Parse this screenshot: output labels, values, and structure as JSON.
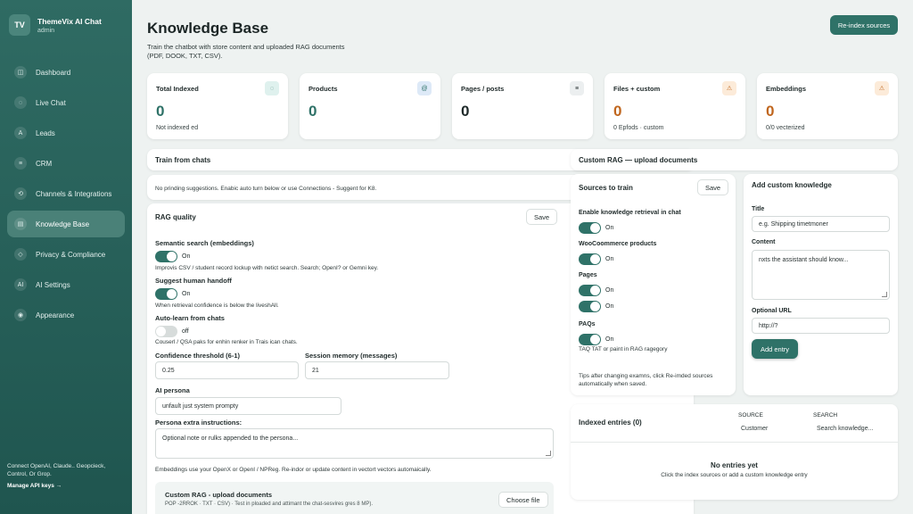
{
  "brand": {
    "initials": "TV",
    "title": "ThemeVix AI Chat",
    "subtitle": "admin"
  },
  "nav": [
    {
      "label": "Dashboard",
      "icon": "grid-icon",
      "glyph": "◫"
    },
    {
      "label": "Live Chat",
      "icon": "chat-icon",
      "glyph": "◌"
    },
    {
      "label": "Leads",
      "icon": "leads-icon",
      "glyph": "A"
    },
    {
      "label": "CRM",
      "icon": "database-icon",
      "glyph": "≡"
    },
    {
      "label": "Channels & Integrations",
      "icon": "channels-icon",
      "glyph": "⟲"
    },
    {
      "label": "Knowledge Base",
      "icon": "book-icon",
      "glyph": "▤"
    },
    {
      "label": "Privacy & Compliance",
      "icon": "shield-icon",
      "glyph": "◇"
    },
    {
      "label": "AI Settings",
      "icon": "ai-icon",
      "glyph": "AI"
    },
    {
      "label": "Appearance",
      "icon": "palette-icon",
      "glyph": "◉"
    }
  ],
  "sidebar_footer": {
    "text": "Connect OpenAI, Claude.. Geopcieck, Control, Or Grop.",
    "link": "Manage API keys →"
  },
  "header": {
    "title": "Knowledge Base",
    "subtitle": "Train the chatbot with store content and uploaded RAG documents (PDF, DOOK, TXT, CSV).",
    "reindex_label": "Re-index sources"
  },
  "stats": [
    {
      "label": "Total Indexed",
      "value": "0",
      "sub": "Not indexed ed",
      "icon": "chat-bubble-icon",
      "glyph": "◌",
      "color": "#2f7268",
      "icon_bg": "#dff1ee"
    },
    {
      "label": "Products",
      "value": "0",
      "sub": "",
      "icon": "at-icon",
      "glyph": "@",
      "color": "#2f7268",
      "icon_bg": "#dde9f7"
    },
    {
      "label": "Pages / posts",
      "value": "0",
      "sub": "",
      "icon": "list-icon",
      "glyph": "≡",
      "color": "#1f2a2a",
      "icon_bg": "#eceff0"
    },
    {
      "label": "Files + custom",
      "value": "0",
      "sub": "0 Epfods · custom",
      "icon": "warning-icon",
      "glyph": "⚠",
      "color": "#c0661e",
      "icon_bg": "#fcebd9"
    },
    {
      "label": "Embeddings",
      "value": "0",
      "sub": "0/0 vecterized",
      "icon": "warning-icon",
      "glyph": "⚠",
      "color": "#c0661e",
      "icon_bg": "#fcebd9"
    }
  ],
  "train_from_chats": {
    "title": "Train from chats",
    "text": "No prinding suggestions. Enabic auto turn below or use Connections - Suggent for K8."
  },
  "rag_quality": {
    "title": "RAG quality",
    "save_label": "Save",
    "semantic": {
      "label": "Semantic search (embeddings)",
      "state": "On",
      "on": true,
      "help": "Improvis CSV / student record lockup with netict search. Search; OpenI? or Gemni key."
    },
    "handoff": {
      "label": "Suggest human handoff",
      "state": "On",
      "on": true,
      "help": "When retrieval confidence is below the liveshAll."
    },
    "autolearn": {
      "label": "Auto-learn from chats",
      "state": "off",
      "on": false,
      "help": "Couserl / QSA paks for enhin renker in Trais ican chats."
    },
    "confidence": {
      "label": "Confidence threshold (6-1)",
      "value": "0.25"
    },
    "memory": {
      "label": "Session memory (messages)",
      "value": "21"
    },
    "persona": {
      "label": "AI persona",
      "value": "unfault just system prompty"
    },
    "persona_extra": {
      "label": "Persona extra instructions:",
      "placeholder": "Optional note or rulks appended to the persona..."
    },
    "footnote": "Embeddings use your OpenX or OpenI / NPReg. Re-indor or update content in vectort vectors automaically."
  },
  "custom_rag_inner": {
    "title": "Custom RAG - upload documents",
    "sub": "POP -2RROK · TXT · CSV)  ·  Test in ploaded and attimant the chat-sesvires gres 8 MP).",
    "button": "Choose file"
  },
  "custom_rag": {
    "title": "Custom RAG — upload documents"
  },
  "sources": {
    "title": "Sources to train",
    "save_label": "Save",
    "items": [
      {
        "label": "Enable knowledge retrieval in chat",
        "state": "On",
        "on": true
      },
      {
        "label": "WooCoommerce products",
        "state": "On",
        "on": true
      },
      {
        "label": "Pages",
        "state": "On",
        "on": true
      },
      {
        "label": "",
        "state": "On",
        "on": true
      },
      {
        "label": "PAQs",
        "state": "On",
        "on": true
      }
    ],
    "faq_help": "TAQ TAT or paint in RAG ragegory",
    "tips": "Tips after changing examns, click Re-imded sources automatically when saved."
  },
  "add_custom": {
    "title": "Add custom knowledge",
    "title_label": "Title",
    "title_placeholder": "e.g. Shipping timetmoner",
    "content_label": "Content",
    "content_placeholder": "nxts the assistant should know...",
    "url_label": "Optional URL",
    "url_placeholder": "http://?",
    "add_label": "Add entry"
  },
  "indexed": {
    "title": "Indexed entries (0)",
    "source_label": "SOURCE",
    "source_value": "Customer",
    "search_label": "SEARCH",
    "search_placeholder": "Search knowledge...",
    "empty_title": "No entries yet",
    "empty_text": "Click the index sources or add a custom knowledge entry"
  },
  "colors": {
    "accent": "#2f7268",
    "sidebar": "#245c55",
    "warning": "#c0661e"
  }
}
